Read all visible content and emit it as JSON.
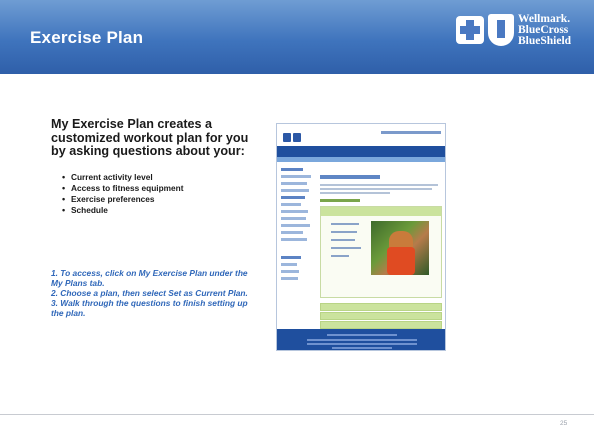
{
  "header": {
    "title": "Exercise Plan",
    "logo_lines": [
      "Wellmark.",
      "BlueCross",
      "BlueShield"
    ]
  },
  "content": {
    "heading": "My Exercise Plan creates a customized workout plan for you by asking questions about your:",
    "bullets": [
      "Current activity level",
      "Access to fitness equipment",
      "Exercise preferences",
      "Schedule"
    ],
    "steps": [
      "1. To access, click on My Exercise Plan under the My Plans tab.",
      "2. Choose a plan, then select Set as Current Plan.",
      "3. Walk through the questions to finish setting up the plan."
    ]
  },
  "footer": {
    "page_number": "25"
  },
  "colors": {
    "header_blue": "#3f74bd",
    "step_text": "#2f67b9",
    "thumb_nav": "#1f4f9e",
    "thumb_green": "#cbe39d"
  }
}
